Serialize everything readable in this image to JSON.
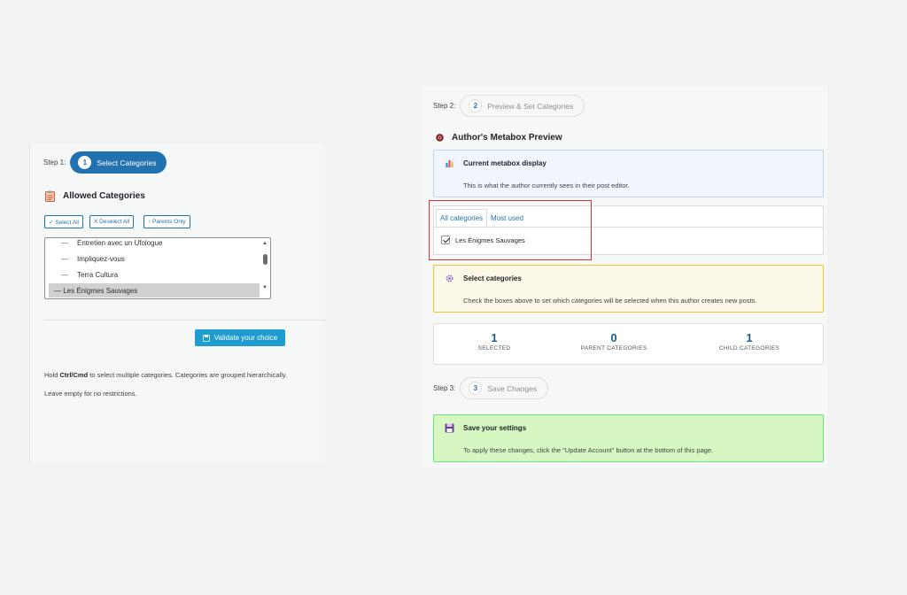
{
  "left": {
    "step_label": "Step 1:",
    "step_num": "1",
    "step_pill": "Select Categories",
    "heading": "Allowed Categories",
    "buttons": {
      "select_all": "✓ Select All",
      "deselect_all": "X Deselect All",
      "parents_only": "↑ Parents Only"
    },
    "categories": [
      {
        "dash": "—",
        "label": "Entretien avec un Ufologue",
        "selected": false
      },
      {
        "dash": "—",
        "label": "Impliquez-vous",
        "selected": false
      },
      {
        "dash": "—",
        "label": "Terra Cultura",
        "selected": false
      },
      {
        "dash": "",
        "label": "— Les Énigmes Sauvages",
        "selected": true
      }
    ],
    "validate_button": "Validate your choice",
    "help_prefix": "Hold ",
    "help_keys": "Ctrl/Cmd",
    "help_suffix": " to select multiple categories. Categories are grouped hierarchically.",
    "help_line2": "Leave empty for no restrictions."
  },
  "right": {
    "step2_label": "Step 2:",
    "step2_num": "2",
    "step2_pill": "Preview & Set Categories",
    "preview_heading": "Author's Metabox Preview",
    "current_card": {
      "title": "Current metabox display",
      "desc": "This is what the author currently sees in their post editor."
    },
    "metabox": {
      "tab_all": "All categories",
      "tab_most": "Most used",
      "checked_item": "Les Énigmes Sauvages"
    },
    "select_card": {
      "title": "Select categories",
      "desc": "Check the boxes above to set which categories will be selected when this author creates new posts."
    },
    "stats": [
      {
        "value": "1",
        "label": "SELECTED"
      },
      {
        "value": "0",
        "label": "PARENT CATEGORIES"
      },
      {
        "value": "1",
        "label": "CHILD CATEGORIES"
      }
    ],
    "step3_label": "Step 3:",
    "step3_num": "3",
    "step3_pill": "Save Changes",
    "save_card": {
      "title": "Save your settings",
      "desc": "To apply these changes, click the \"Update Account\" button at the bottom of this page."
    }
  },
  "colors": {
    "accent": "#2271b1",
    "info_bg": "#f0f6fc",
    "warn_bg": "#fcf9e8",
    "success_bg": "#d7f7c2",
    "highlight": "#d63638"
  }
}
